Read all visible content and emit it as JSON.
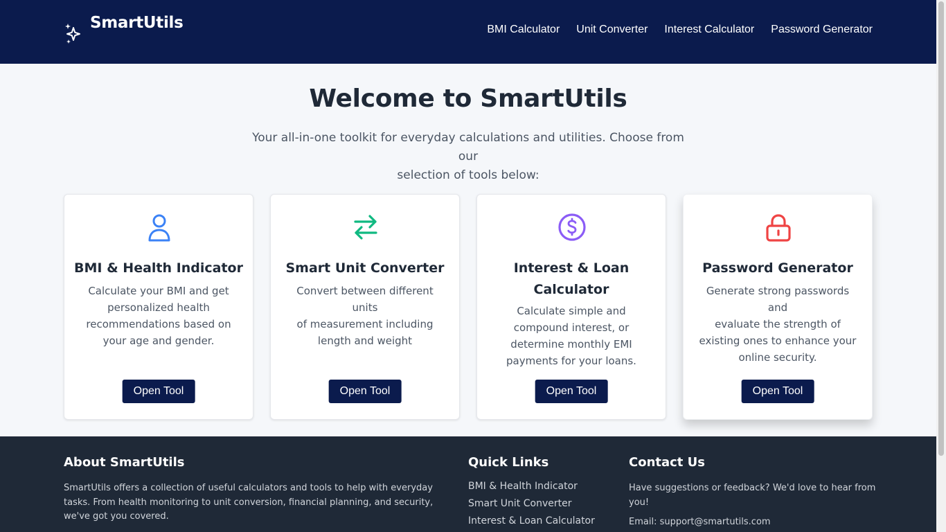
{
  "header": {
    "brand": "SmartUtils",
    "nav": [
      {
        "label": "BMI Calculator"
      },
      {
        "label": "Unit Converter"
      },
      {
        "label": "Interest Calculator"
      },
      {
        "label": "Password Generator"
      }
    ]
  },
  "hero": {
    "title": "Welcome to SmartUtils",
    "subtitle_line1": "Your all-in-one toolkit for everyday calculations and utilities. Choose from our",
    "subtitle_line2": "selection of tools below:"
  },
  "cards": [
    {
      "icon": "user-icon",
      "icon_color": "#3b82f6",
      "title_lines": [
        "BMI & Health Indicator"
      ],
      "desc_lines": [
        "Calculate your BMI and get",
        "personalized health",
        "recommendations based on",
        "your age and gender."
      ],
      "button": "Open Tool"
    },
    {
      "icon": "arrows-swap-icon",
      "icon_color": "#10b981",
      "title_lines": [
        "Smart Unit Converter"
      ],
      "desc_lines": [
        "Convert between different units",
        "of measurement including",
        "length and weight"
      ],
      "button": "Open Tool"
    },
    {
      "icon": "dollar-circle-icon",
      "icon_color": "#8b5cf6",
      "title_lines": [
        "Interest & Loan",
        "Calculator"
      ],
      "desc_lines": [
        "Calculate simple and",
        "compound interest, or",
        "determine monthly EMI",
        "payments for your loans."
      ],
      "button": "Open Tool"
    },
    {
      "icon": "lock-icon",
      "icon_color": "#ef4444",
      "title_lines": [
        "Password Generator"
      ],
      "desc_lines": [
        "Generate strong passwords and",
        "evaluate the strength of",
        "existing ones to enhance your",
        "online security."
      ],
      "button": "Open Tool"
    }
  ],
  "footer": {
    "about": {
      "heading": "About SmartUtils",
      "lines": [
        "SmartUtils offers a collection of useful calculators and tools to help with everyday",
        "tasks. From health monitoring to unit conversion, financial planning, and security,",
        "we've got you covered."
      ]
    },
    "quick_links": {
      "heading": "Quick Links",
      "links": [
        "BMI & Health Indicator",
        "Smart Unit Converter",
        "Interest & Loan Calculator"
      ]
    },
    "contact": {
      "heading": "Contact Us",
      "lines": [
        "Have suggestions or feedback? We'd love to hear from",
        "you!"
      ],
      "email": "Email: support@smartutils.com"
    }
  },
  "colors": {
    "header_bg": "#0b1b4d",
    "footer_bg": "#1f2937",
    "page_bg": "#f5f7fa",
    "button_bg": "#0b1b4d"
  }
}
